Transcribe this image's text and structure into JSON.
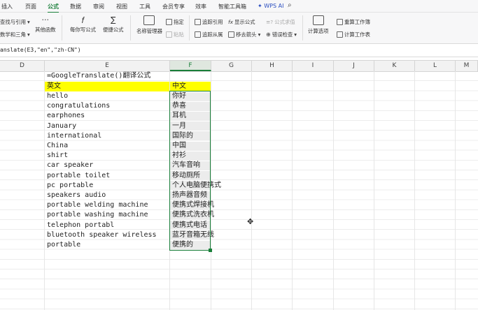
{
  "menu": {
    "tabs": [
      "插入",
      "页面",
      "公式",
      "数据",
      "审阅",
      "视图",
      "工具",
      "会员专享",
      "效率",
      "智能工具箱",
      "WPS AI"
    ]
  },
  "ribbon": {
    "lookup": "查找与引用",
    "math": "数学和三角",
    "other_func": "其他函数",
    "everyday": "每你写公式",
    "convenient": "便捷公式",
    "name_mgr": "名称管理器",
    "specify": "指定",
    "paste": "粘贴",
    "trace_pre": "追踪引用",
    "trace_dep": "追踪从属",
    "show_formula": "显示公式",
    "formula_eval": "公式求值",
    "remove_arrows": "移去箭头",
    "error_check": "错误检查",
    "calc_options": "计算选项",
    "recalc_book": "重算工作簿",
    "calc_sheet": "计算工作表"
  },
  "formula_bar": "anslate(E3,\"en\",\"zh-CN\")",
  "columns": [
    "D",
    "E",
    "F",
    "G",
    "H",
    "I",
    "J",
    "K",
    "L",
    "M"
  ],
  "sheet": {
    "title": "=GoogleTranslate()翻译公式",
    "header_en": "英文",
    "header_zh": "中文",
    "english": [
      "hello",
      "congratulations",
      "earphones",
      "January",
      "international",
      "China",
      "shirt",
      "car speaker",
      "portable toilet",
      "pc portable",
      "speakers audio",
      "portable welding machine",
      "portable washing machine",
      "telephon portabl",
      "bluetooth speaker wireless",
      "portable"
    ],
    "chinese": [
      "你好",
      "恭喜",
      "耳机",
      "一月",
      "国际的",
      "中国",
      "衬衫",
      "汽车音响",
      "移动厕所",
      "个人电脑便携式",
      "扬声器音频",
      "便携式焊接机",
      "便携式洗衣机",
      "便携式电话",
      "蓝牙音箱无线",
      "便携的"
    ]
  },
  "colors": {
    "accent": "#1a7f3a",
    "highlight": "#ffff00"
  }
}
